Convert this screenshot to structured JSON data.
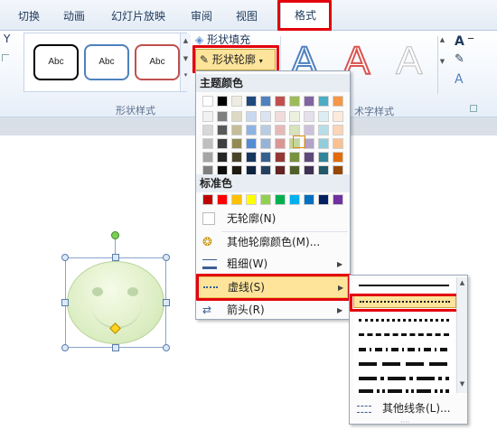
{
  "tabs": [
    "切换",
    "动画",
    "幻灯片放映",
    "审阅",
    "视图",
    "格式"
  ],
  "ribbon": {
    "left_fragment": "Y",
    "style_thumbs": [
      "Abc",
      "Abc",
      "Abc"
    ],
    "shape_fill": "形状填充",
    "shape_outline": "形状轮廓",
    "shape_styles_group": "形状样式",
    "art_text_group": "术字样式"
  },
  "outline_menu": {
    "theme_colors_header": "主题颜色",
    "standard_colors_header": "标准色",
    "no_outline": "无轮廓(N)",
    "more_colors": "其他轮廓颜色(M)...",
    "weight": "粗细(W)",
    "dashes": "虚线(S)",
    "arrows": "箭头(R)",
    "standard_colors": [
      "#c00000",
      "#ff0000",
      "#ffc000",
      "#ffff00",
      "#92d050",
      "#00b050",
      "#00b0f0",
      "#0070c0",
      "#002060",
      "#7030a0"
    ],
    "theme_columns": [
      [
        "#ffffff",
        "#f2f2f2",
        "#d8d8d8",
        "#bfbfbf",
        "#a5a5a5",
        "#7f7f7f"
      ],
      [
        "#000000",
        "#7f7f7f",
        "#595959",
        "#3f3f3f",
        "#262626",
        "#0c0c0c"
      ],
      [
        "#eeece1",
        "#ddd9c3",
        "#c4bd97",
        "#938953",
        "#494429",
        "#1d1b10"
      ],
      [
        "#1f497d",
        "#c6d9f0",
        "#8db3e2",
        "#548dd4",
        "#17365d",
        "#0f243e"
      ],
      [
        "#4f81bd",
        "#dbe5f1",
        "#b8cce4",
        "#95b3d7",
        "#366092",
        "#244061"
      ],
      [
        "#c0504d",
        "#f2dcdb",
        "#e5b9b7",
        "#d99694",
        "#953734",
        "#632423"
      ],
      [
        "#9bbb59",
        "#ebf1dd",
        "#d7e3bc",
        "#c3d69b",
        "#76923c",
        "#4f6128"
      ],
      [
        "#8064a2",
        "#e5e0ec",
        "#ccc1d9",
        "#b2a2c7",
        "#5f497a",
        "#3f3151"
      ],
      [
        "#4bacc6",
        "#dbeef3",
        "#b7dde8",
        "#92cddc",
        "#31859b",
        "#205867"
      ],
      [
        "#f79646",
        "#fdeada",
        "#fbd5b5",
        "#fac08f",
        "#e36c09",
        "#974806"
      ]
    ]
  },
  "dash_menu": {
    "more_lines": "其他线条(L)..."
  },
  "colors": {
    "highlight": "#e3000b",
    "menu_hover": "#fde49a"
  }
}
